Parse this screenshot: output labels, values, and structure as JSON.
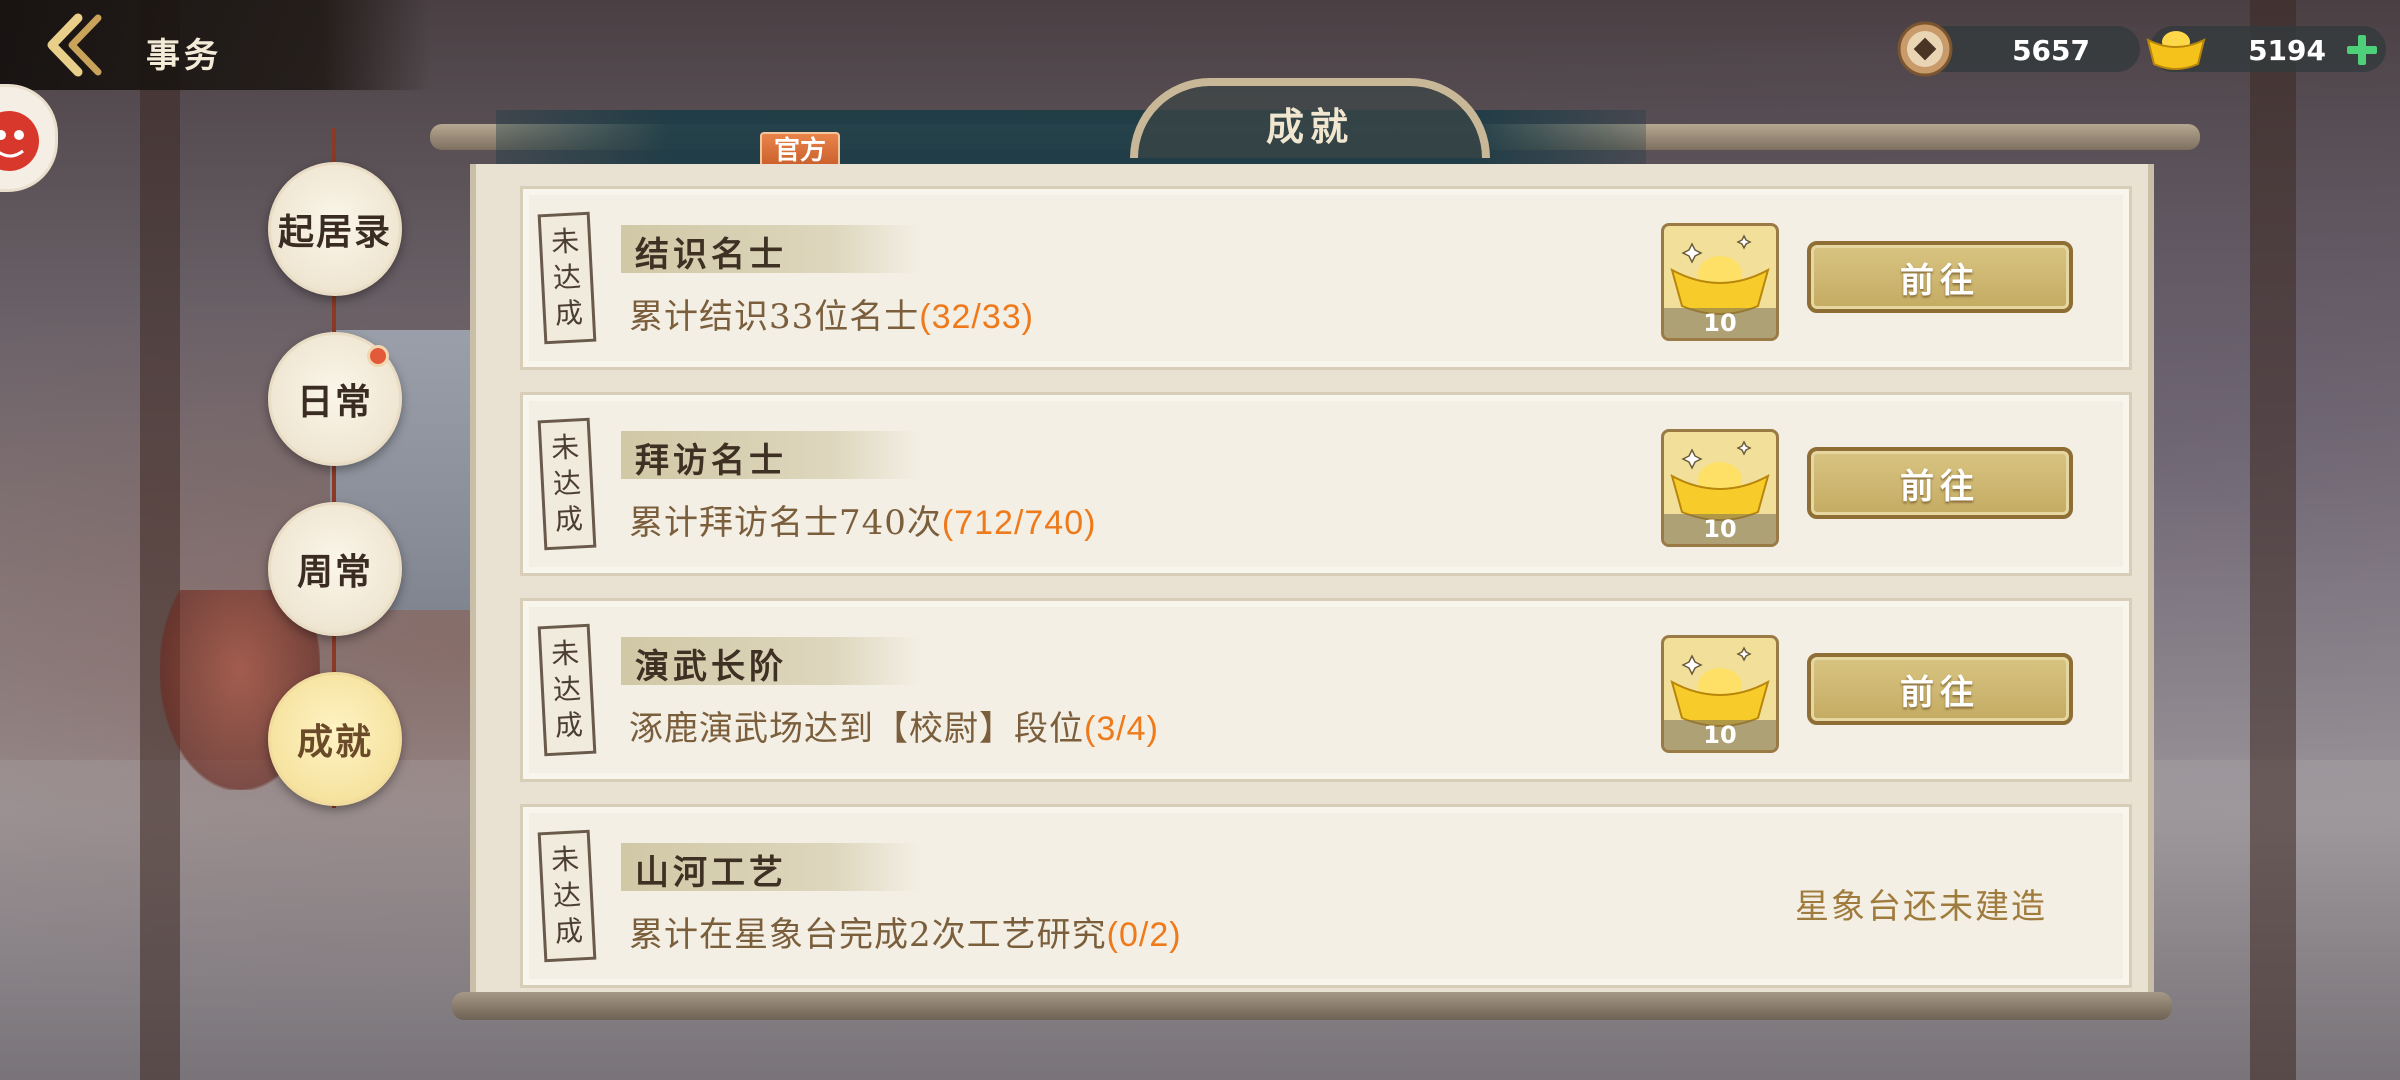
{
  "header": {
    "title": "事务"
  },
  "currency": {
    "copper": {
      "icon": "copper-coin-icon",
      "value": "5657"
    },
    "gold": {
      "icon": "gold-ingot-icon",
      "value": "5194"
    }
  },
  "tabs": [
    {
      "label": "起居录",
      "active": false,
      "badge": false
    },
    {
      "label": "日常",
      "active": false,
      "badge": true
    },
    {
      "label": "周常",
      "active": false,
      "badge": false
    },
    {
      "label": "成就",
      "active": true,
      "badge": false
    }
  ],
  "panel": {
    "title": "成就",
    "tag": "官方",
    "items": [
      {
        "seal": [
          "未",
          "达",
          "成"
        ],
        "name": "结识名士",
        "desc": "累计结识33位名士",
        "progress": "(32/33)",
        "reward_icon": "gold-ingot-icon",
        "reward_count": "10",
        "action": "前往"
      },
      {
        "seal": [
          "未",
          "达",
          "成"
        ],
        "name": "拜访名士",
        "desc": "累计拜访名士740次",
        "progress": "(712/740)",
        "reward_icon": "gold-ingot-icon",
        "reward_count": "10",
        "action": "前往"
      },
      {
        "seal": [
          "未",
          "达",
          "成"
        ],
        "name": "演武长阶",
        "desc": "涿鹿演武场达到【校尉】段位",
        "progress": "(3/4)",
        "reward_icon": "gold-ingot-icon",
        "reward_count": "10",
        "action": "前往"
      },
      {
        "seal": [
          "未",
          "达",
          "成"
        ],
        "name": "山河工艺",
        "desc": "累计在星象台完成2次工艺研究",
        "progress": "(0/2)",
        "status": "星象台还未建造"
      }
    ]
  },
  "colors": {
    "progress": "#ee7a1c",
    "button": "#c4ab62",
    "badge": "#e25a3a"
  }
}
